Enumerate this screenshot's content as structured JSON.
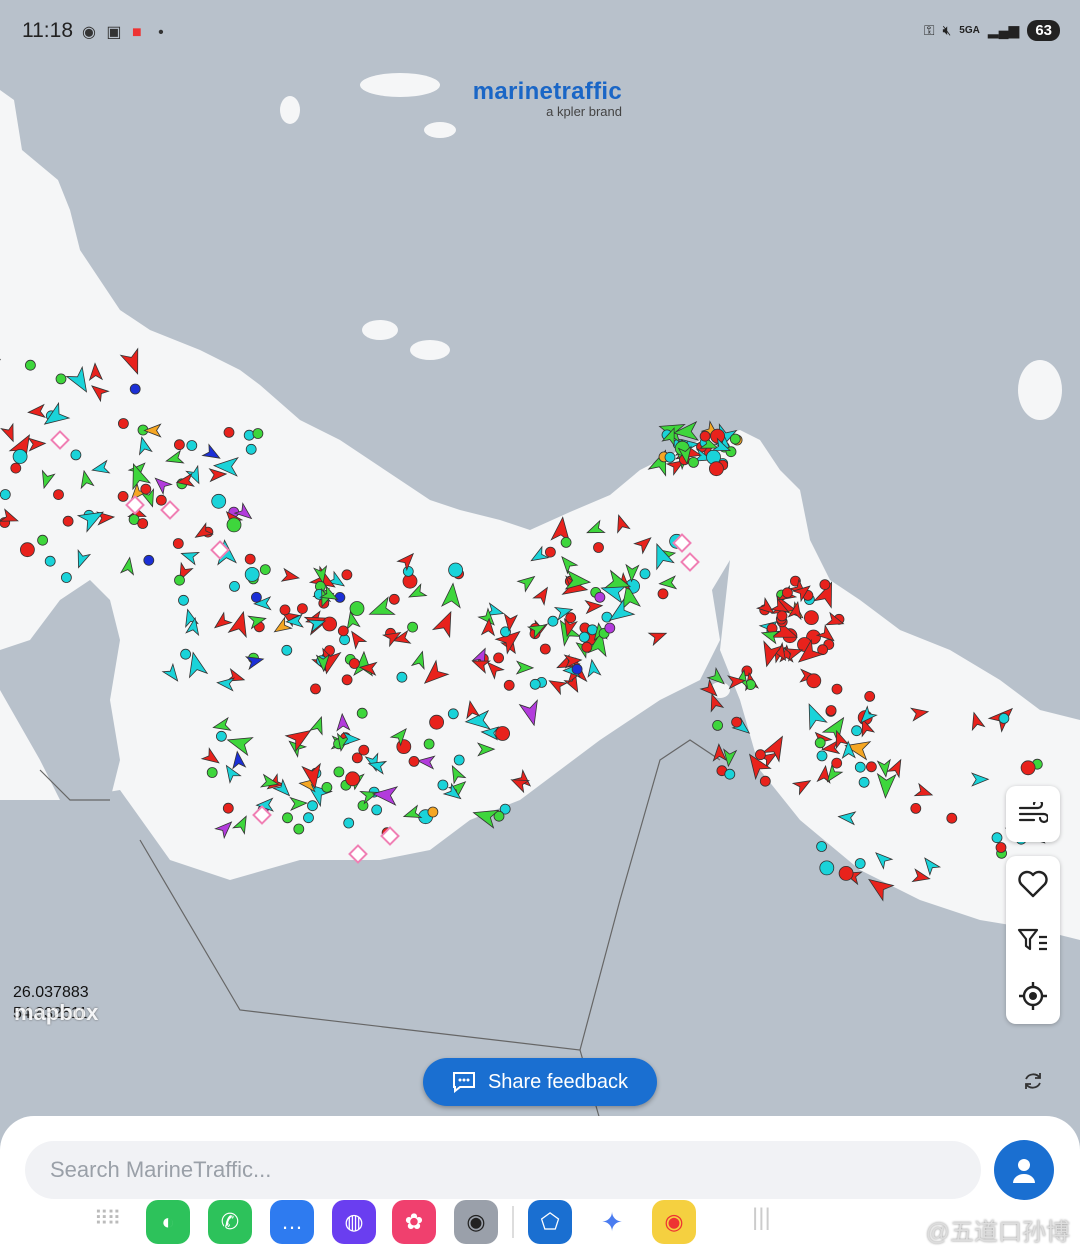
{
  "status_bar": {
    "time": "11:18",
    "network": "5GA",
    "battery": "63"
  },
  "brand": {
    "name": "marinetraffic",
    "sub": "a kpler brand"
  },
  "map": {
    "latitude": "26.037883",
    "longitude": "54.832511",
    "attribution": "mapbox",
    "vessel_colors": {
      "tanker": "#e8221c",
      "cargo": "#3ed63c",
      "passenger": "#1ad3d9",
      "special": "#b23bdc",
      "pleasure": "#f07fb4",
      "fishing": "#f5a623",
      "tug": "#1b2fd6"
    }
  },
  "side_panel": {
    "items": [
      "wind-icon",
      "favorite-icon",
      "filter-list-icon",
      "locate-icon"
    ]
  },
  "feedback_button": {
    "label": "Share feedback"
  },
  "search": {
    "placeholder": "Search MarineTraffic..."
  },
  "dock": {
    "apps": [
      "wechat",
      "phone",
      "messages",
      "browser",
      "gallery",
      "camera",
      "vpn",
      "gemini",
      "weibo"
    ]
  },
  "watermark": "@五道口孙博"
}
